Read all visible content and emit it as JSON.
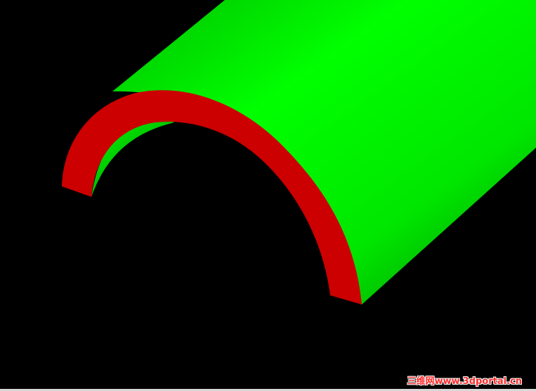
{
  "scene": {
    "background_color": "#000000",
    "tube_outer_color": "#00ff00",
    "tube_shade_color": "#00b000",
    "cross_section_color": "#cc0000"
  },
  "watermark": {
    "text": "三维网www.3dportal.cn"
  }
}
